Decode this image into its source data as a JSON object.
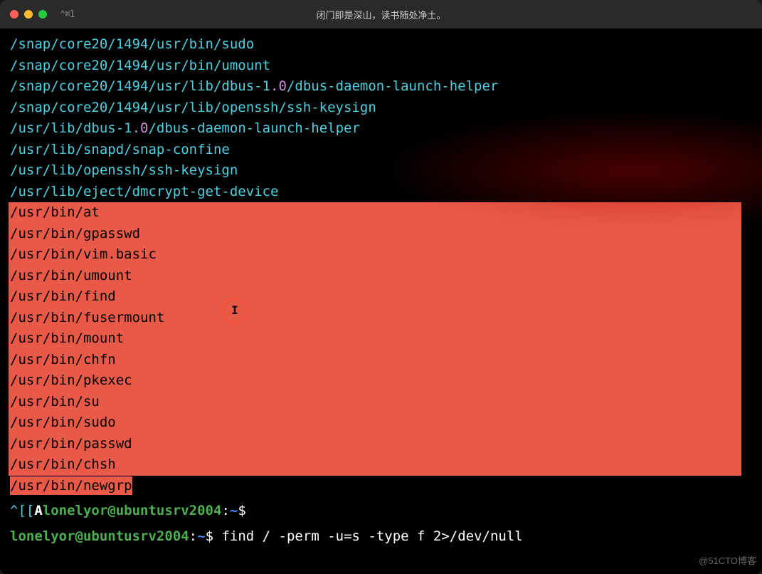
{
  "window": {
    "title": "闭门即是深山，读书随处净土。",
    "tab_indicator": "⌃⌘1"
  },
  "output": {
    "cyan_lines": [
      "/snap/core20/1494/usr/bin/sudo",
      "/snap/core20/1494/usr/bin/umount",
      "/snap/core20/1494/usr/lib/dbus-1.0/dbus-daemon-launch-helper",
      "/snap/core20/1494/usr/lib/openssh/ssh-keysign",
      "/usr/lib/dbus-1.0/dbus-daemon-launch-helper",
      "/usr/lib/snapd/snap-confine",
      "/usr/lib/openssh/ssh-keysign",
      "/usr/lib/eject/dmcrypt-get-device"
    ],
    "highlighted_lines": [
      "/usr/bin/at",
      "/usr/bin/gpasswd",
      "/usr/bin/vim.basic",
      "/usr/bin/umount",
      "/usr/bin/find",
      "/usr/bin/fusermount",
      "/usr/bin/mount",
      "/usr/bin/chfn",
      "/usr/bin/pkexec",
      "/usr/bin/su",
      "/usr/bin/sudo",
      "/usr/bin/passwd",
      "/usr/bin/chsh"
    ],
    "last_highlighted": "/usr/bin/newgrp"
  },
  "prompt1": {
    "prefix": "^[[A",
    "user": "lonelyor@ubuntusrv2004",
    "sep": ":",
    "path": "~",
    "end": "$"
  },
  "prompt2": {
    "user": "lonelyor@ubuntusrv2004",
    "sep": ":",
    "path": "~",
    "end": "$",
    "command": "find / -perm -u=s -type f 2>/dev/null"
  },
  "watermark": "@51CTO博客"
}
